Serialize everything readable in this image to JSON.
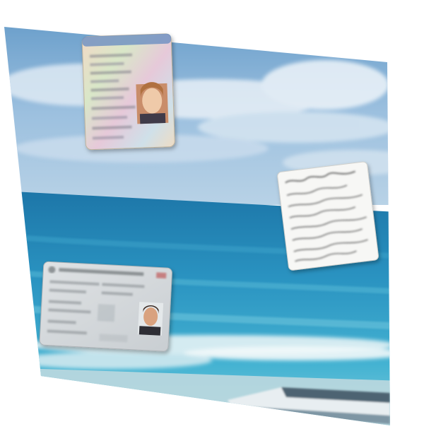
{
  "scene": {
    "description_hidden": "",
    "colors": {
      "sky_top": "#6fa3cf",
      "sky_mid": "#9fc3e0",
      "cloud": "#e4eef7",
      "horizon": "#2f88b7",
      "sea_deep": "#1f7fb0",
      "sea_mid": "#37a3c9",
      "sea_shallow": "#7fd0df",
      "foam": "#dfeff3",
      "sand": "#c9dbe0",
      "boat": "#5a6f7e",
      "card_id_bg": "#e9dcc9",
      "card_id_border": "#c6bba5",
      "card_pass_bg": "#d9dcdf",
      "card_note_bg": "#f7f7f5"
    },
    "cards": {
      "id_card": {
        "header": "",
        "photo": "woman-portrait"
      },
      "note_card": {
        "kind": "handwritten-note"
      },
      "pass_card": {
        "header": "",
        "photo": "man-portrait"
      }
    }
  }
}
